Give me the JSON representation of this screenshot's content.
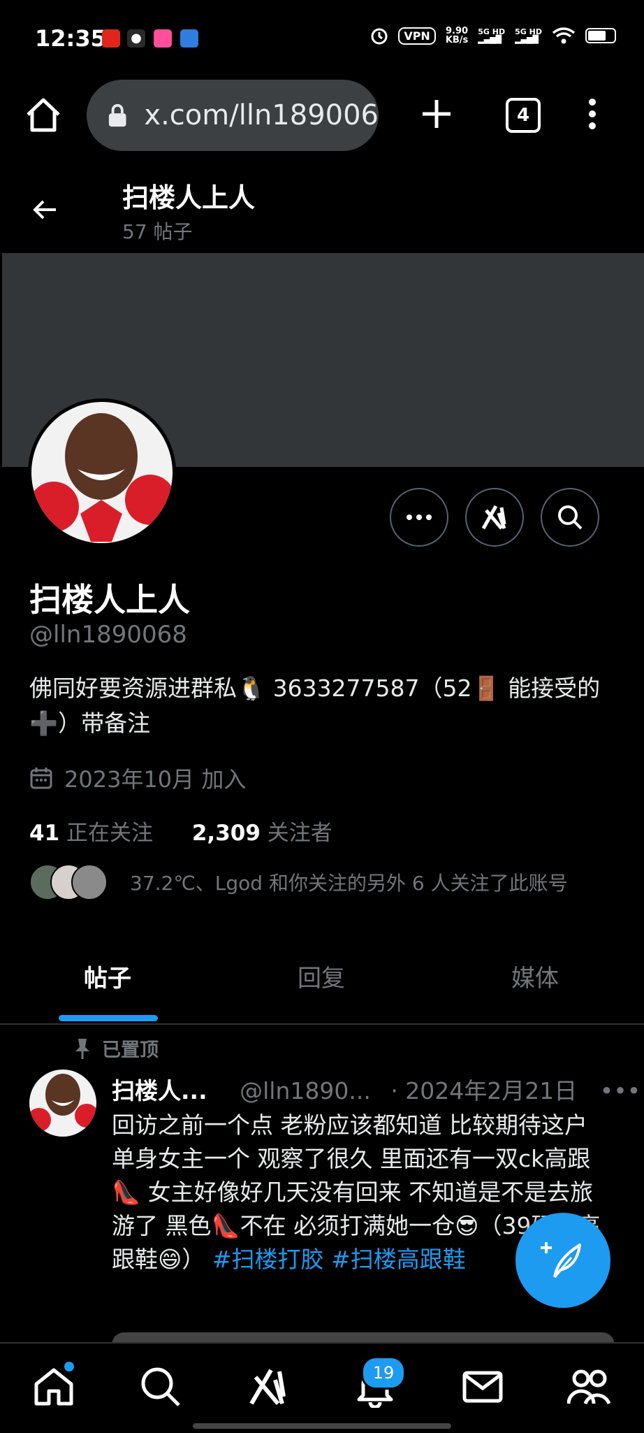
{
  "status_bar": {
    "time": "12:35",
    "vpn": "VPN",
    "speed_value": "9.90",
    "speed_unit": "KB/s",
    "sim1": "5G HD",
    "sim2": "5G HD",
    "battery_level": 0.7
  },
  "browser": {
    "url": "x.com/lln189006",
    "tab_count": "4"
  },
  "header": {
    "name": "扫楼人上人",
    "post_count": "57 帖子"
  },
  "profile": {
    "display_name": "扫楼人上人",
    "handle": "@lln1890068",
    "bio": "佛同好要资源进群私🐧 3633277587（52🚪 能接受的➕）带备注",
    "joined": "2023年10月 加入",
    "following_count": "41",
    "following_label": "正在关注",
    "followers_count": "2,309",
    "followers_label": "关注者",
    "followed_by_text": "37.2℃、Lgod 和你关注的另外 6 人关注了此账号"
  },
  "tabs": [
    "帖子",
    "回复",
    "媒体"
  ],
  "pinned_post": {
    "pinned_label": "已置顶",
    "author_name": "扫楼人...",
    "author_handle": "@lln1890...",
    "date": "· 2024年2月21日",
    "more": "•••",
    "text": "回访之前一个点 老粉应该都知道 比较期待这户 单身女主一个 观察了很久 里面还有一双ck高跟👠 女主好像好几天没有回来 不知道是不是去旅游了 黑色👠不在 必须打满她一仓😎（39码的高跟鞋😄）",
    "hashtag1": "#扫楼打胶",
    "hashtag2": "#扫楼高跟鞋"
  },
  "bottom_nav": {
    "notification_badge": "19"
  },
  "colors": {
    "accent": "#1d9bf0",
    "background": "#000000",
    "banner": "#333639",
    "muted_text": "#71767b"
  }
}
